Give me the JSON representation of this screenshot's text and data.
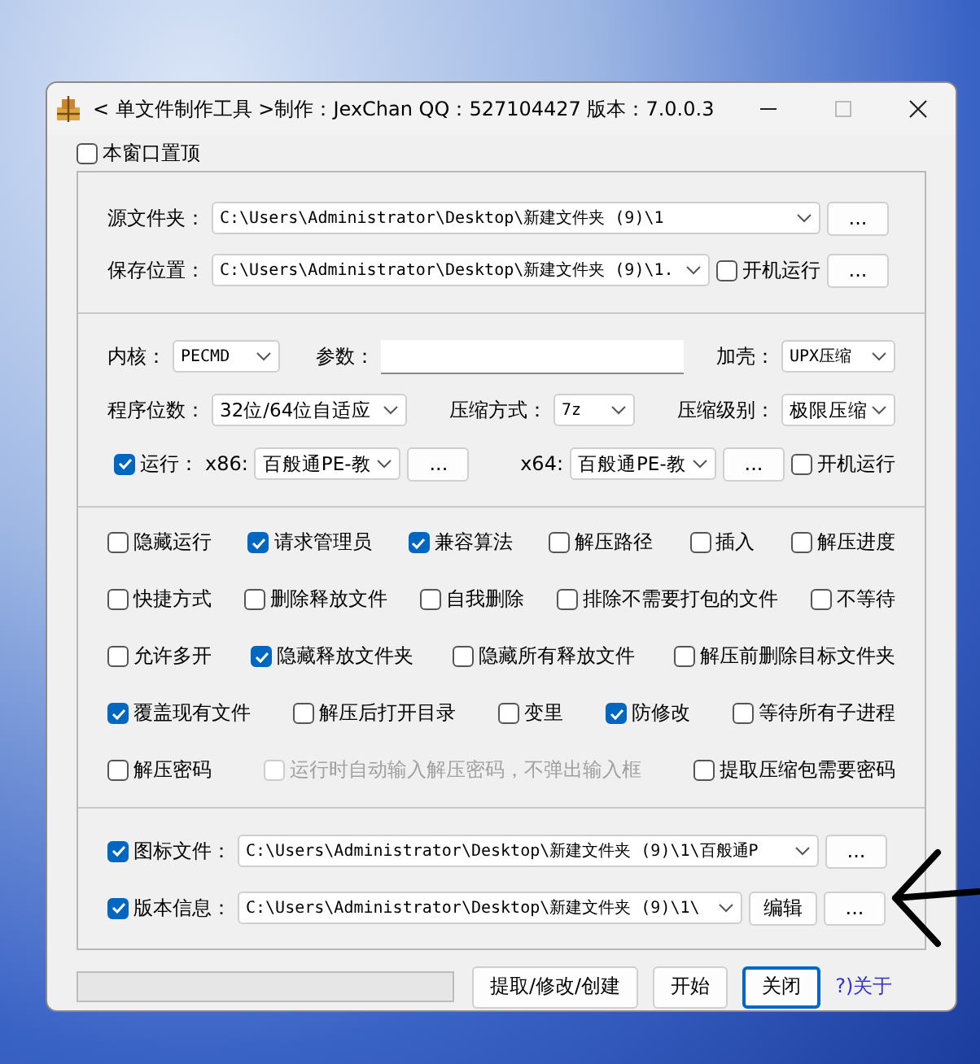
{
  "window": {
    "title": "< 单文件制作工具 >制作：JexChan  QQ：527104427  版本：7.0.0.3"
  },
  "topmost": {
    "label": "本窗口置顶",
    "checked": false
  },
  "source": {
    "label": "源文件夹：",
    "value": "C:\\Users\\Administrator\\Desktop\\新建文件夹 (9)\\1",
    "button": "..."
  },
  "save": {
    "label": "保存位置：",
    "value": "C:\\Users\\Administrator\\Desktop\\新建文件夹 (9)\\1.",
    "autorun": {
      "label": "开机运行",
      "checked": false
    },
    "button": "..."
  },
  "kernel": {
    "label": "内核：",
    "value": "PECMD"
  },
  "params": {
    "label": "参数："
  },
  "shell": {
    "label": "加壳：",
    "value": "UPX压缩"
  },
  "bits": {
    "label": "程序位数：",
    "value": "32位/64位自适应"
  },
  "method": {
    "label": "压缩方式：",
    "value": "7z"
  },
  "compression": {
    "label": "压缩级别：",
    "value": "极限压缩"
  },
  "run": {
    "label": "运行：",
    "checked": true,
    "x86": {
      "label": "x86:",
      "value": "百般通PE-教",
      "button": "..."
    },
    "x64": {
      "label": "x64:",
      "value": "百般通PE-教",
      "button": "..."
    },
    "autorun": {
      "label": "开机运行",
      "checked": false
    }
  },
  "options": [
    [
      {
        "label": "隐藏运行",
        "checked": false,
        "disabled": false
      },
      {
        "label": "请求管理员",
        "checked": true,
        "disabled": false
      },
      {
        "label": "兼容算法",
        "checked": true,
        "disabled": false
      },
      {
        "label": "解压路径",
        "checked": false,
        "disabled": false
      },
      {
        "label": "插入",
        "checked": false,
        "disabled": false
      },
      {
        "label": "解压进度",
        "checked": false,
        "disabled": false
      }
    ],
    [
      {
        "label": "快捷方式",
        "checked": false,
        "disabled": false
      },
      {
        "label": "删除释放文件",
        "checked": false,
        "disabled": false
      },
      {
        "label": "自我删除",
        "checked": false,
        "disabled": false
      },
      {
        "label": "排除不需要打包的文件",
        "checked": false,
        "disabled": false
      },
      {
        "label": "不等待",
        "checked": false,
        "disabled": false
      }
    ],
    [
      {
        "label": "允许多开",
        "checked": false,
        "disabled": false
      },
      {
        "label": "隐藏释放文件夹",
        "checked": true,
        "disabled": false
      },
      {
        "label": "隐藏所有释放文件",
        "checked": false,
        "disabled": false
      },
      {
        "label": "解压前删除目标文件夹",
        "checked": false,
        "disabled": false
      }
    ],
    [
      {
        "label": "覆盖现有文件",
        "checked": true,
        "disabled": false
      },
      {
        "label": "解压后打开目录",
        "checked": false,
        "disabled": false
      },
      {
        "label": "变里",
        "checked": false,
        "disabled": false
      },
      {
        "label": "防修改",
        "checked": true,
        "disabled": false
      },
      {
        "label": "等待所有子进程",
        "checked": false,
        "disabled": false
      }
    ],
    [
      {
        "label": "解压密码",
        "checked": false,
        "disabled": false
      },
      {
        "label": "运行时自动输入解压密码，不弹出输入框",
        "checked": false,
        "disabled": true
      },
      {
        "label": "提取压缩包需要密码",
        "checked": false,
        "disabled": false
      }
    ]
  ],
  "resources": [
    {
      "label": "图标文件：",
      "checked": true,
      "value": "C:\\Users\\Administrator\\Desktop\\新建文件夹 (9)\\1\\百般通P",
      "buttons": [
        "..."
      ]
    },
    {
      "label": "版本信息：",
      "checked": true,
      "value": "C:\\Users\\Administrator\\Desktop\\新建文件夹 (9)\\1\\",
      "buttons": [
        "编辑",
        "..."
      ]
    }
  ],
  "footer": {
    "progress": {
      "level": 0
    },
    "buttons": [
      {
        "label": "提取/修改/创建",
        "focused": false
      },
      {
        "label": "开始",
        "focused": false
      },
      {
        "label": "关闭",
        "focused": true
      }
    ],
    "about": "?)关于"
  }
}
